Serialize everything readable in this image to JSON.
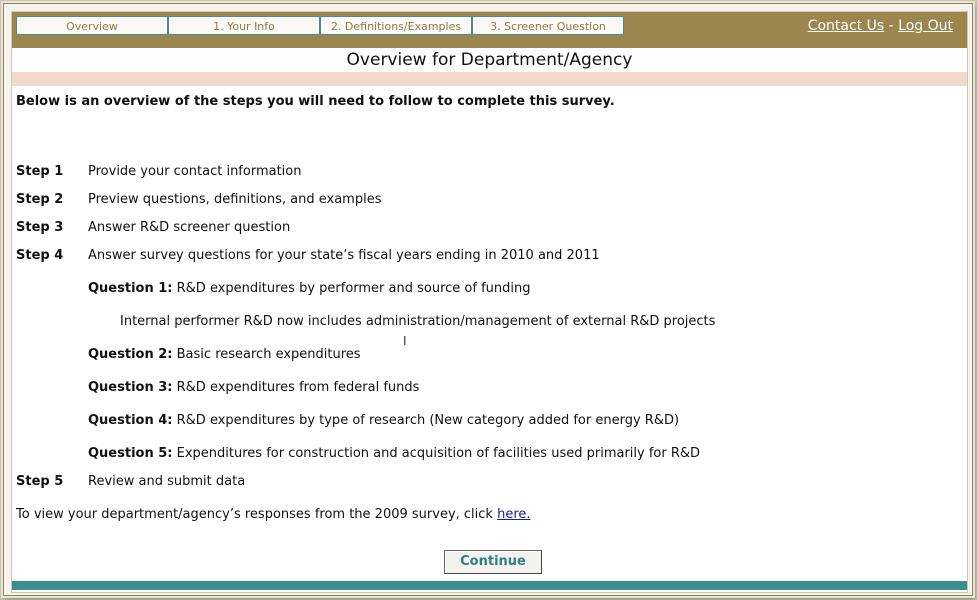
{
  "nav": {
    "tabs": [
      "Overview",
      "1. Your Info",
      "2. Definitions/Examples",
      "3. Screener Question"
    ],
    "contact_label": "Contact Us",
    "separator": "-",
    "logout_label": "Log Out"
  },
  "page": {
    "title": "Overview for Department/Agency",
    "intro": "Below is an overview of the steps you will need to follow to complete this survey."
  },
  "steps": [
    {
      "label": "Step 1",
      "text": "Provide your contact information"
    },
    {
      "label": "Step 2",
      "text": "Preview questions, definitions, and examples"
    },
    {
      "label": "Step 3",
      "text": "Answer R&D screener question"
    },
    {
      "label": "Step 4",
      "text": "Answer survey questions for your state’s fiscal years ending in 2010 and 2011"
    },
    {
      "label": "Step 5",
      "text": "Review and submit data"
    }
  ],
  "questions": [
    {
      "label": "Question 1:",
      "text": "R&D expenditures by performer and source of funding"
    },
    {
      "label": "Question 2:",
      "text": "Basic research expenditures"
    },
    {
      "label": "Question 3:",
      "text": "R&D expenditures from federal funds"
    },
    {
      "label": "Question 4:",
      "text": "R&D expenditures by type of research (New category added for energy R&D)"
    },
    {
      "label": "Question 5:",
      "text": "Expenditures for construction and acquisition of facilities used primarily for R&D"
    }
  ],
  "question1_note": "Internal performer R&D now includes administration/management of external R&D projects",
  "previous_responses": {
    "text": "To view your department/agency’s responses from the 2009 survey, click ",
    "link_label": "here."
  },
  "continue_label": "Continue",
  "colors": {
    "header_bar": "#9b8650",
    "tab_border": "#4e8c8b",
    "pink_band": "#f2d9cc",
    "footer_bar": "#3a8e8d",
    "continue_text": "#2f7f82",
    "link": "#1a1aa8"
  }
}
